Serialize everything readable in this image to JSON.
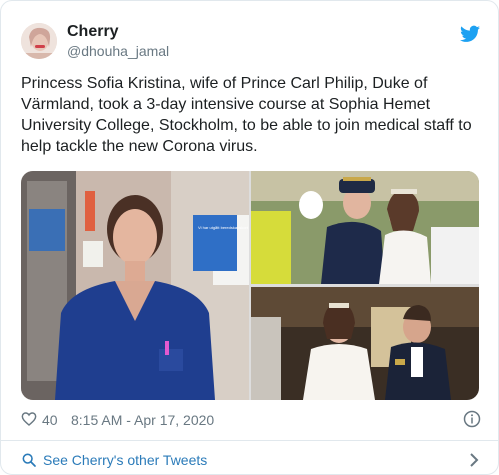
{
  "tweet": {
    "author_name": "Cherry",
    "author_handle": "@dhouha_jamal",
    "text": "Princess Sofia Kristina, wife of Prince Carl Philip, Duke of Värmland, took a 3-day intensive course at Sophia Hemet University College, Stockholm, to be able to join medical staff to help tackle the new Corona virus.",
    "likes": "40",
    "timestamp": "8:15 AM - Apr 17, 2020",
    "footer_link": "See Cherry's other Tweets",
    "sign_text": "Vi har utgått beredskapskort"
  },
  "icons": {
    "bird": "twitter-bird-icon",
    "heart": "heart-icon",
    "info": "info-icon",
    "search": "search-icon",
    "chevron": "chevron-right-icon"
  },
  "colors": {
    "brand": "#1da1f2",
    "link": "#2b7bb9",
    "muted": "#697882",
    "text": "#1c2022",
    "border": "#e1e8ed"
  }
}
